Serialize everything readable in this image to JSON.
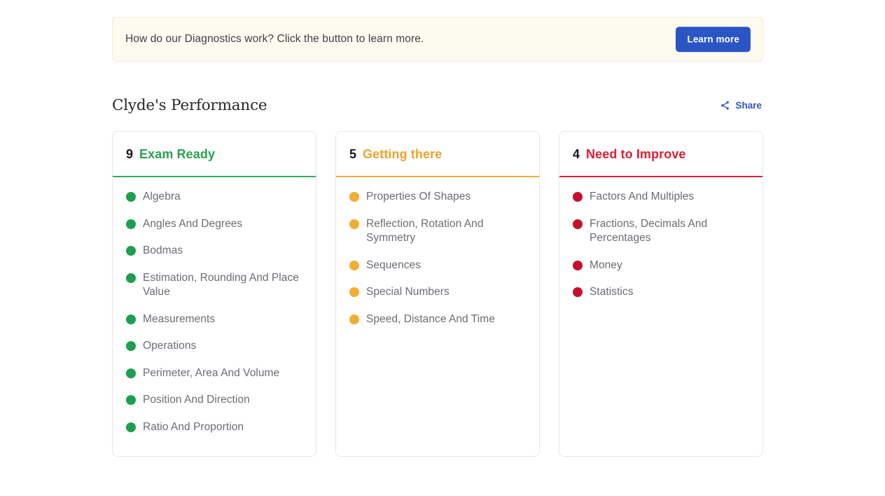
{
  "banner": {
    "text": "How do our Diagnostics work? Click the button to learn more.",
    "button_label": "Learn more",
    "background_color": "#fdfaef",
    "button_color": "#2b54c4"
  },
  "header": {
    "title": "Clyde's Performance",
    "share_label": "Share",
    "share_icon": "share-nodes-icon",
    "share_color": "#2b54c4"
  },
  "columns": [
    {
      "key": "exam-ready",
      "count": "9",
      "label": "Exam Ready",
      "color": "#2ba04f",
      "dot_color": "#1e9e4f",
      "topics": [
        "Algebra",
        "Angles And Degrees",
        "Bodmas",
        "Estimation, Rounding And Place Value",
        "Measurements",
        "Operations",
        "Perimeter, Area And Volume",
        "Position And Direction",
        "Ratio And Proportion"
      ]
    },
    {
      "key": "getting-there",
      "count": "5",
      "label": "Getting there",
      "color": "#f2a22c",
      "dot_color": "#f2ad35",
      "topics": [
        "Properties Of Shapes",
        "Reflection, Rotation And Symmetry",
        "Sequences",
        "Special Numbers",
        "Speed, Distance And Time"
      ]
    },
    {
      "key": "need-to-improve",
      "count": "4",
      "label": "Need to Improve",
      "color": "#da1f33",
      "dot_color": "#c7102b",
      "topics": [
        "Factors And Multiples",
        "Fractions, Decimals And Percentages",
        "Money",
        "Statistics"
      ]
    }
  ]
}
